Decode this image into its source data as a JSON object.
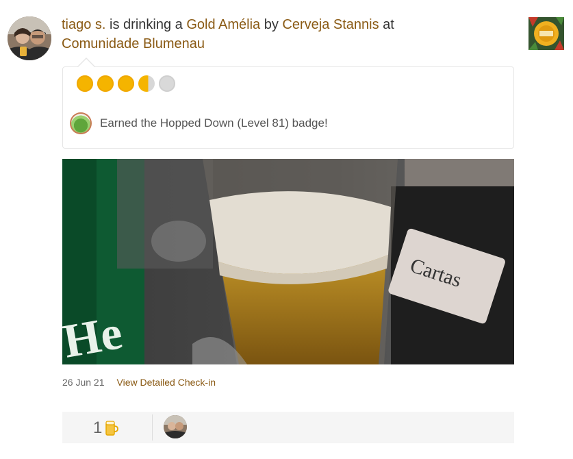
{
  "checkin": {
    "user": "tiago s.",
    "verb": "is drinking a",
    "beer": "Gold Amélia",
    "by_word": "by",
    "brewery": "Cerveja Stannis",
    "at_word": "at",
    "venue": "Comunidade Blumenau"
  },
  "rating": {
    "value": 3.75,
    "max": 5
  },
  "badge": {
    "text": "Earned the Hopped Down (Level 81) badge!",
    "icon": "badge-hopped-down-icon"
  },
  "photo": {
    "alt": "beer glass photo"
  },
  "meta": {
    "date": "26 Jun 21",
    "detail_link": "View Detailed Check-in"
  },
  "toasts": {
    "count": "1"
  },
  "colors": {
    "link": "#8a5a14",
    "cap": "#f5b400",
    "cap_empty": "#d9d9d9",
    "footer_bg": "#f5f5f5"
  }
}
